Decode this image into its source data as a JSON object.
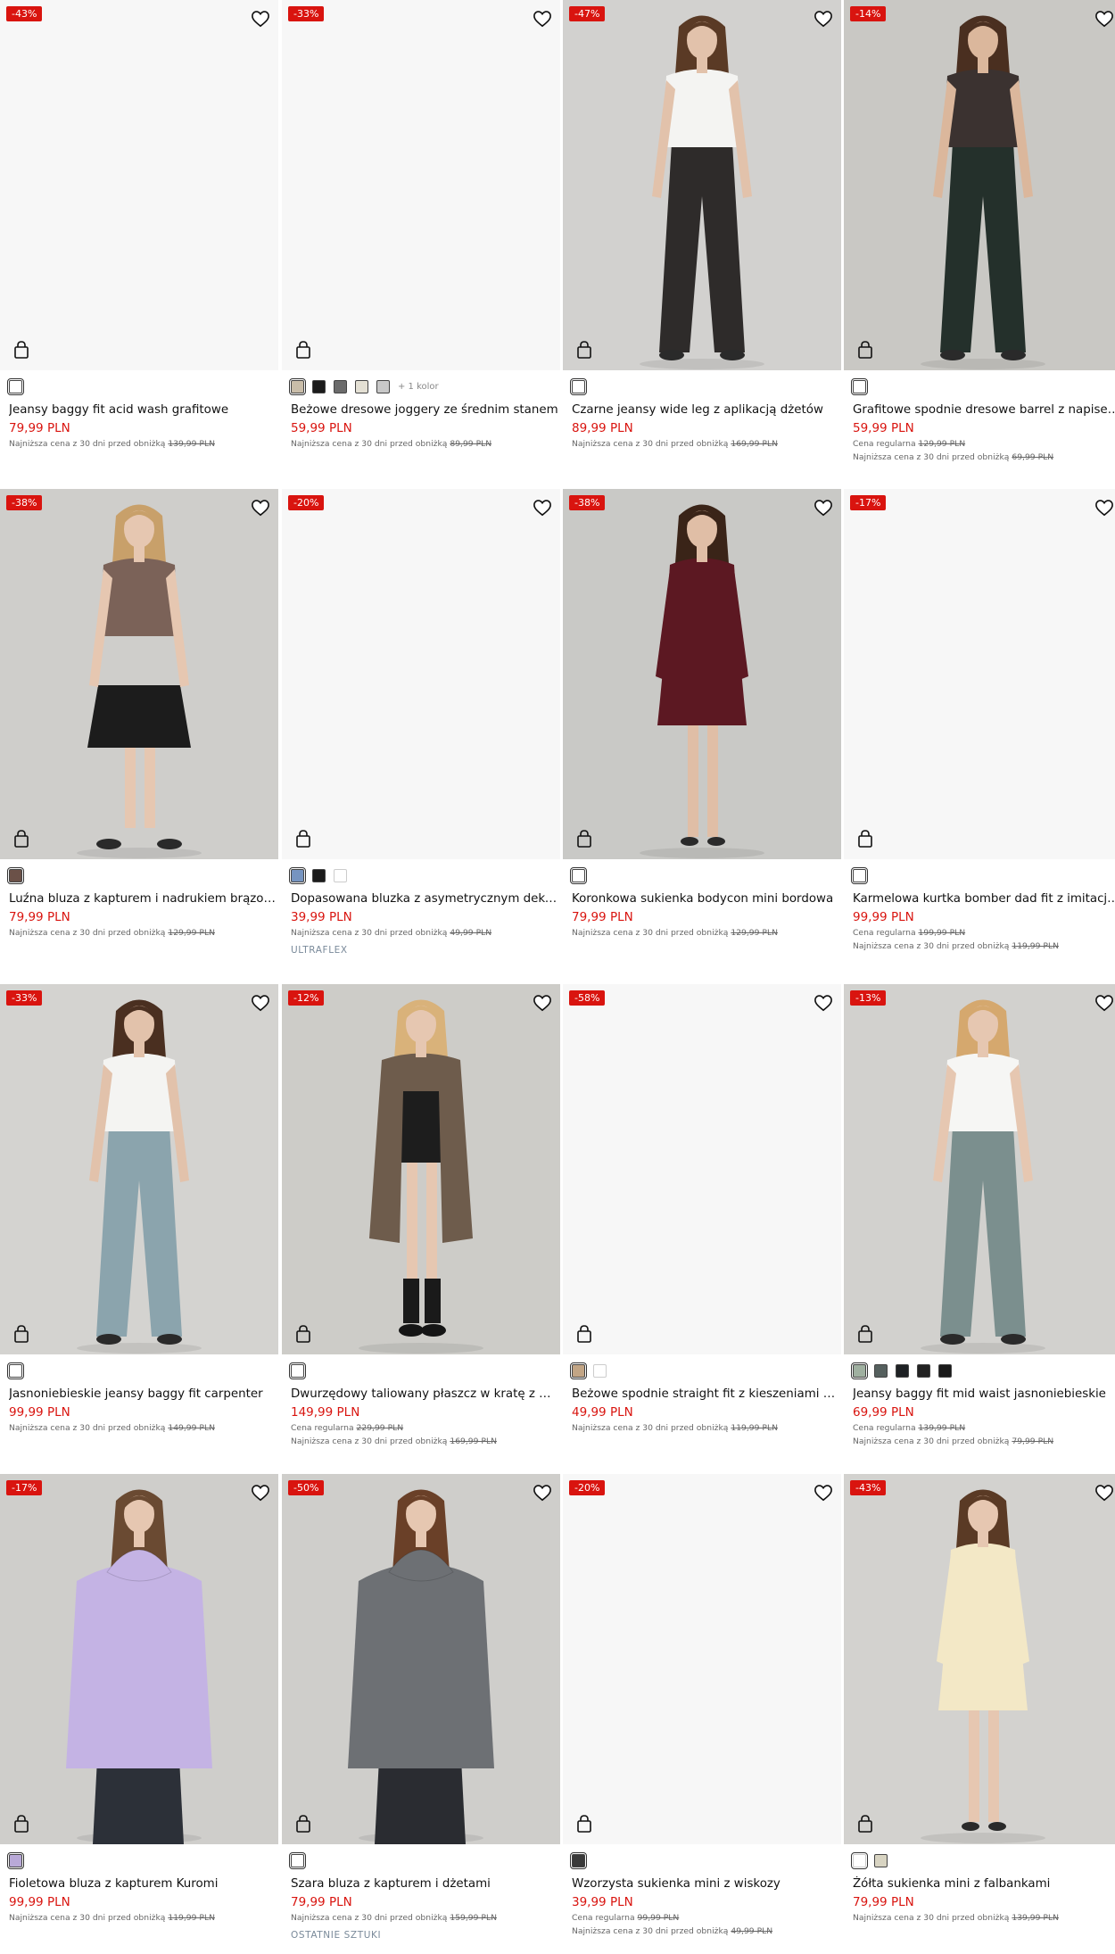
{
  "products": [
    {
      "badge": "-43%",
      "name": "Jeansy baggy fit acid wash grafitowe",
      "price": "79,99 PLN",
      "lowest_label": "Najniższa cena z 30 dni przed obniżką",
      "lowest_price": "139,99 PLN",
      "swatches": [
        "#ffffff"
      ],
      "swatch_selected": 0,
      "photo": {
        "kind": "empty"
      }
    },
    {
      "badge": "-33%",
      "name": "Beżowe dresowe joggery ze średnim stanem",
      "price": "59,99 PLN",
      "lowest_label": "Najniższa cena z 30 dni przed obniżką",
      "lowest_price": "89,99 PLN",
      "swatches": [
        "#c9bda9",
        "#1b1b1b",
        "#6b6b6b",
        "#e4e0d4",
        "#c8c8c8"
      ],
      "swatch_selected": 0,
      "more_colors": "+ 1 kolor",
      "photo": {
        "kind": "empty"
      }
    },
    {
      "badge": "-47%",
      "name": "Czarne jeansy wide leg z aplikacją dżetów",
      "price": "89,99 PLN",
      "lowest_label": "Najniższa cena z 30 dni przed obniżką",
      "lowest_price": "169,99 PLN",
      "swatches": [
        "#ffffff"
      ],
      "swatch_selected": 0,
      "photo": {
        "kind": "model",
        "bg": "#d2d1cf",
        "top": "#f4f4f2",
        "bottom": "#2e2b2a",
        "hair": "#5a3a25",
        "skin": "#e2c2ab",
        "bottom_long": true
      }
    },
    {
      "badge": "-14%",
      "name": "Grafitowe spodnie dresowe barrel z napise…",
      "price": "59,99 PLN",
      "regular_label": "Cena regularna",
      "regular_price": "129,99 PLN",
      "lowest_label": "Najniższa cena z 30 dni przed obniżką",
      "lowest_price": "69,99 PLN",
      "swatches": [
        "#ffffff"
      ],
      "swatch_selected": 0,
      "photo": {
        "kind": "model",
        "bg": "#c9c8c4",
        "top": "#3b3230",
        "bottom": "#24302b",
        "hair": "#4a2f20",
        "skin": "#dbb79c",
        "bottom_long": true
      }
    },
    {
      "badge": "-38%",
      "name": "Luźna bluza z kapturem i nadrukiem brązowa",
      "price": "79,99 PLN",
      "lowest_label": "Najniższa cena z 30 dni przed obniżką",
      "lowest_price": "129,99 PLN",
      "swatches": [
        "#6b5148"
      ],
      "swatch_selected": 0,
      "photo": {
        "kind": "model",
        "bg": "#cfcecb",
        "top": "#7b6258",
        "bottom": "#1c1c1c",
        "hair": "#c8a06a",
        "skin": "#e6c7b1",
        "bottom_long": false
      }
    },
    {
      "badge": "-20%",
      "name": "Dopasowana bluzka z asymetrycznym dekol…",
      "price": "39,99 PLN",
      "lowest_label": "Najniższa cena z 30 dni przed obniżką",
      "lowest_price": "49,99 PLN",
      "swatches": [
        "#7694c0",
        "#1b1b1b",
        "#ffffff"
      ],
      "swatch_selected": 0,
      "tag": "ULTRAFLEX",
      "photo": {
        "kind": "empty"
      }
    },
    {
      "badge": "-38%",
      "name": "Koronkowa sukienka bodycon mini bordowa",
      "price": "79,99 PLN",
      "lowest_label": "Najniższa cena z 30 dni przed obniżką",
      "lowest_price": "129,99 PLN",
      "swatches": [
        "#ffffff"
      ],
      "swatch_selected": 0,
      "photo": {
        "kind": "dress",
        "bg": "#c9c9c6",
        "top": "#5c1822",
        "bottom": "#5c1822",
        "hair": "#3a2418",
        "skin": "#e0bea6"
      }
    },
    {
      "badge": "-17%",
      "name": "Karmelowa kurtka bomber dad fit z imitacji …",
      "price": "99,99 PLN",
      "regular_label": "Cena regularna",
      "regular_price": "199,99 PLN",
      "lowest_label": "Najniższa cena z 30 dni przed obniżką",
      "lowest_price": "119,99 PLN",
      "swatches": [
        "#ffffff"
      ],
      "swatch_selected": 0,
      "photo": {
        "kind": "empty"
      }
    },
    {
      "badge": "-33%",
      "name": "Jasnoniebieskie jeansy baggy fit carpenter",
      "price": "99,99 PLN",
      "lowest_label": "Najniższa cena z 30 dni przed obniżką",
      "lowest_price": "149,99 PLN",
      "swatches": [
        "#ffffff"
      ],
      "swatch_selected": 0,
      "photo": {
        "kind": "model",
        "bg": "#d4d3d0",
        "top": "#f4f4f2",
        "bottom": "#8ba4ad",
        "hair": "#4a2f20",
        "skin": "#e2c2ab",
        "bottom_long": true
      }
    },
    {
      "badge": "-12%",
      "name": "Dwurzędowy taliowany płaszcz w kratę z do…",
      "price": "149,99 PLN",
      "regular_label": "Cena regularna",
      "regular_price": "229,99 PLN",
      "lowest_label": "Najniższa cena z 30 dni przed obniżką",
      "lowest_price": "169,99 PLN",
      "swatches": [
        "#ffffff"
      ],
      "swatch_selected": 0,
      "photo": {
        "kind": "coat",
        "bg": "#cdccc8",
        "top": "#6e5c4c",
        "bottom": "#1d1d1d",
        "hair": "#d9b27a",
        "skin": "#e6c7b1"
      }
    },
    {
      "badge": "-58%",
      "name": "Beżowe spodnie straight fit z kieszeniami ca…",
      "price": "49,99 PLN",
      "lowest_label": "Najniższa cena z 30 dni przed obniżką",
      "lowest_price": "119,99 PLN",
      "swatches": [
        "#c2a585",
        "#ffffff"
      ],
      "swatch_selected": 0,
      "photo": {
        "kind": "empty"
      }
    },
    {
      "badge": "-13%",
      "name": "Jeansy baggy fit mid waist jasnoniebieskie",
      "price": "69,99 PLN",
      "regular_label": "Cena regularna",
      "regular_price": "139,99 PLN",
      "lowest_label": "Najniższa cena z 30 dni przed obniżką",
      "lowest_price": "79,99 PLN",
      "swatches": [
        "#9fb0a0",
        "#55605e",
        "#1e2124",
        "#222222",
        "#1a1a1a"
      ],
      "swatch_selected": 0,
      "photo": {
        "kind": "model",
        "bg": "#d2d1ce",
        "top": "#f6f6f4",
        "bottom": "#7b8f8e",
        "hair": "#d5a86e",
        "skin": "#e6c7b1",
        "bottom_long": true
      }
    },
    {
      "badge": "-17%",
      "name": "Fioletowa bluza z kapturem Kuromi",
      "price": "99,99 PLN",
      "lowest_label": "Najniższa cena z 30 dni przed obniżką",
      "lowest_price": "119,99 PLN",
      "swatches": [
        "#b9a9d8"
      ],
      "swatch_selected": 0,
      "photo": {
        "kind": "hoodie",
        "bg": "#cfcecb",
        "top": "#c4b3e4",
        "bottom": "#2c3038",
        "hair": "#6a4a32",
        "skin": "#e6c7b1"
      }
    },
    {
      "badge": "-50%",
      "name": "Szara bluza z kapturem i dżetami",
      "price": "79,99 PLN",
      "lowest_label": "Najniższa cena z 30 dni przed obniżką",
      "lowest_price": "159,99 PLN",
      "swatches": [
        "#ffffff"
      ],
      "swatch_selected": 0,
      "tag": "OSTATNIE SZTUKI",
      "photo": {
        "kind": "hoodie",
        "bg": "#cfcecb",
        "top": "#6d7074",
        "bottom": "#2a2c31",
        "hair": "#6a4028",
        "skin": "#e6c7b1"
      }
    },
    {
      "badge": "-20%",
      "name": "Wzorzysta sukienka mini z wiskozy",
      "price": "39,99 PLN",
      "regular_label": "Cena regularna",
      "regular_price": "99,99 PLN",
      "lowest_label": "Najniższa cena z 30 dni przed obniżką",
      "lowest_price": "49,99 PLN",
      "swatches": [
        "#3a3a3a"
      ],
      "swatch_selected": 0,
      "photo": {
        "kind": "empty"
      }
    },
    {
      "badge": "-43%",
      "name": "Żółta sukienka mini z falbankami",
      "price": "79,99 PLN",
      "lowest_label": "Najniższa cena z 30 dni przed obniżką",
      "lowest_price": "139,99 PLN",
      "swatches": [
        "#ffffff",
        "#d8d4c2"
      ],
      "swatch_selected": 0,
      "photo": {
        "kind": "dress",
        "bg": "#d3d2cf",
        "top": "#f3e8c6",
        "bottom": "#f3e8c6",
        "hair": "#5a3a25",
        "skin": "#e6c7b1"
      }
    }
  ]
}
